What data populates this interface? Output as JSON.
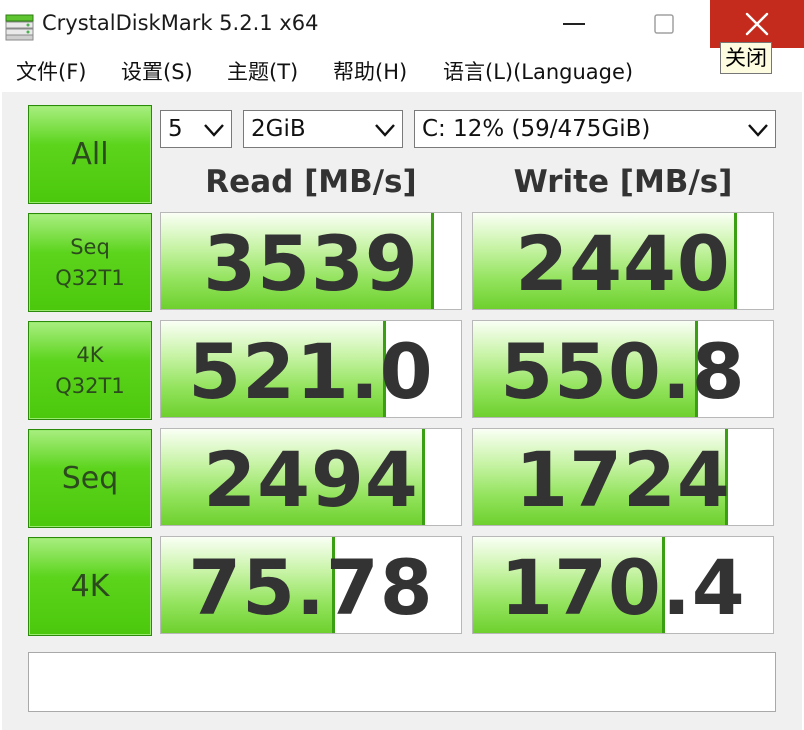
{
  "window": {
    "title": "CrystalDiskMark 5.2.1 x64",
    "close_tooltip": "关闭",
    "accent_close": "#c42b1c"
  },
  "menu": [
    "文件(F)",
    "设置(S)",
    "主题(T)",
    "帮助(H)",
    "语言(L)(Language)"
  ],
  "controls": {
    "count": "5",
    "size": "2GiB",
    "drive": "C: 12% (59/475GiB)"
  },
  "buttons": {
    "all": "All",
    "tests": [
      {
        "line1": "Seq",
        "line2": "Q32T1"
      },
      {
        "line1": "4K",
        "line2": "Q32T1"
      },
      {
        "line1": "Seq",
        "line2": ""
      },
      {
        "line1": "4K",
        "line2": ""
      }
    ]
  },
  "headers": {
    "read": "Read [MB/s]",
    "write": "Write [MB/s]"
  },
  "results": [
    {
      "read": "3539",
      "write": "2440",
      "read_fill": 0.9,
      "write_fill": 0.87
    },
    {
      "read": "521.0",
      "write": "550.8",
      "read_fill": 0.74,
      "write_fill": 0.74
    },
    {
      "read": "2494",
      "write": "1724",
      "read_fill": 0.87,
      "write_fill": 0.84
    },
    {
      "read": "75.78",
      "write": "170.4",
      "read_fill": 0.57,
      "write_fill": 0.63
    }
  ],
  "comment": ""
}
